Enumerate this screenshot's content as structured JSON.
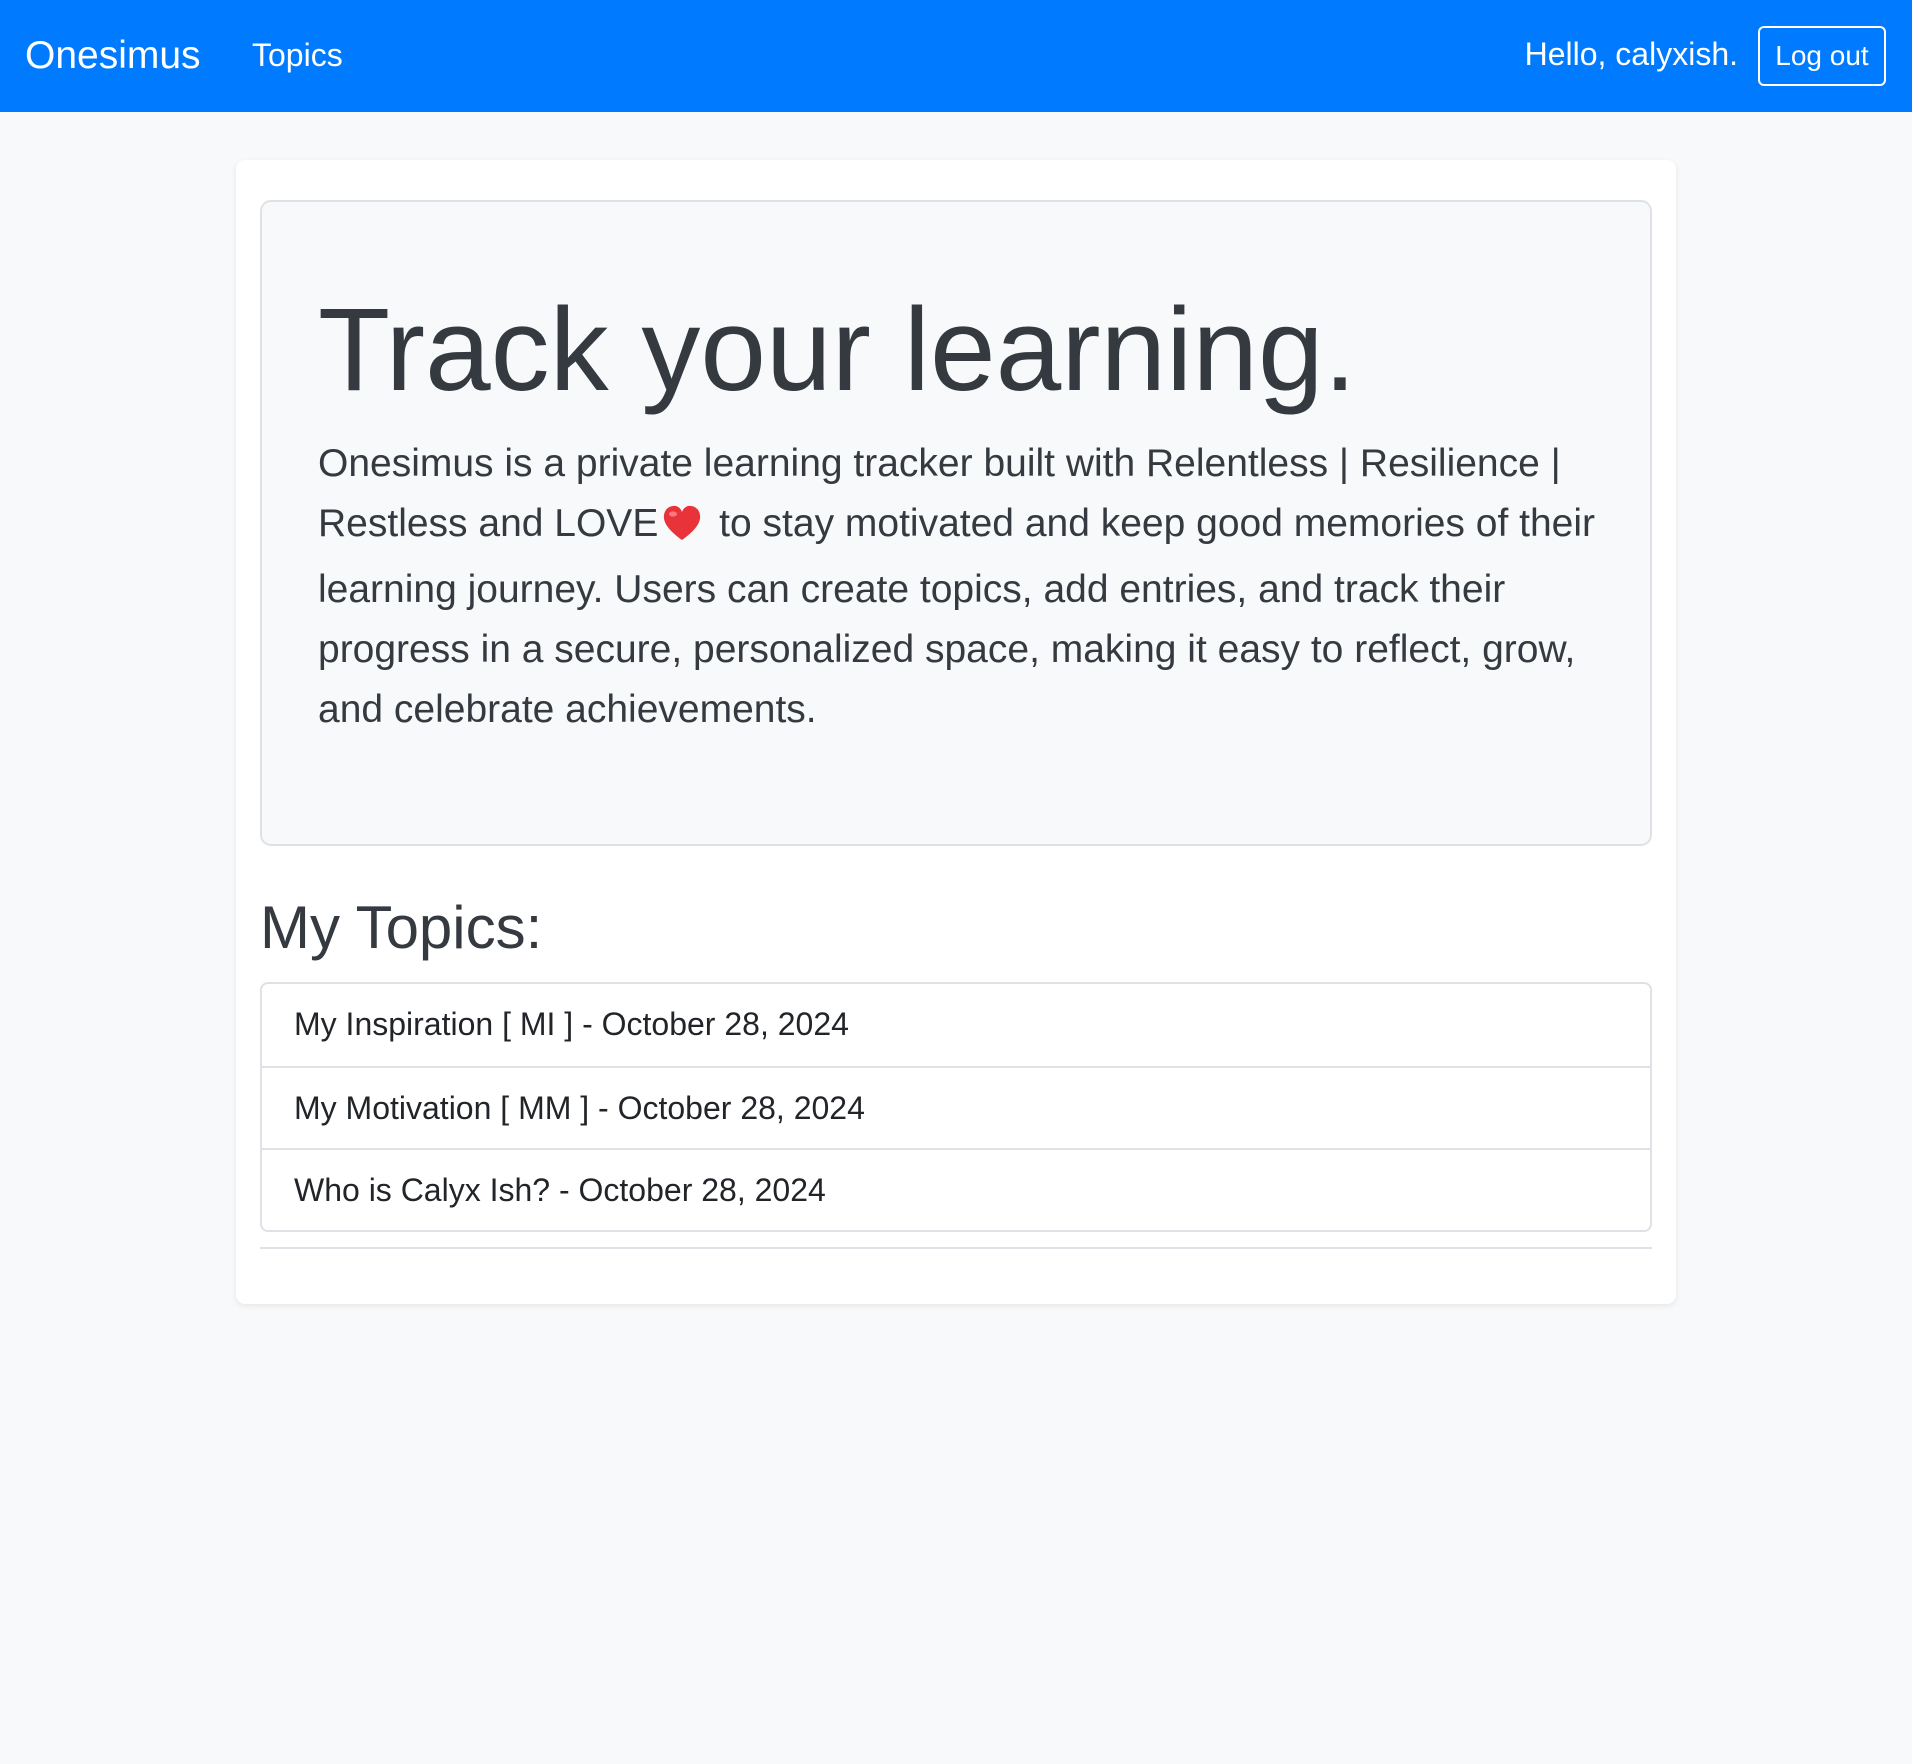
{
  "navbar": {
    "brand": "Onesimus",
    "topics_link": "Topics",
    "greeting": "Hello, calyxish.",
    "logout_label": "Log out"
  },
  "hero": {
    "title": "Track your learning.",
    "text_before_icon": "Onesimus is a private learning tracker built with Relentless | Resilience | Restless and LOVE",
    "icon": "heart-icon",
    "text_after_icon": " to stay motivated and keep good memories of their learning journey. Users can create topics, add entries, and track their progress in a secure, personalized space, making it easy to reflect, grow, and celebrate achievements."
  },
  "topics_section": {
    "heading": "My Topics:",
    "items": [
      {
        "label": "My Inspiration [ MI ] - October 28, 2024"
      },
      {
        "label": "My Motivation [ MM ] - October 28, 2024"
      },
      {
        "label": "Who is Calyx Ish? - October 28, 2024"
      }
    ]
  },
  "colors": {
    "primary": "#007bff",
    "page_background": "#f8f9fa",
    "heart": "#e8333a"
  }
}
